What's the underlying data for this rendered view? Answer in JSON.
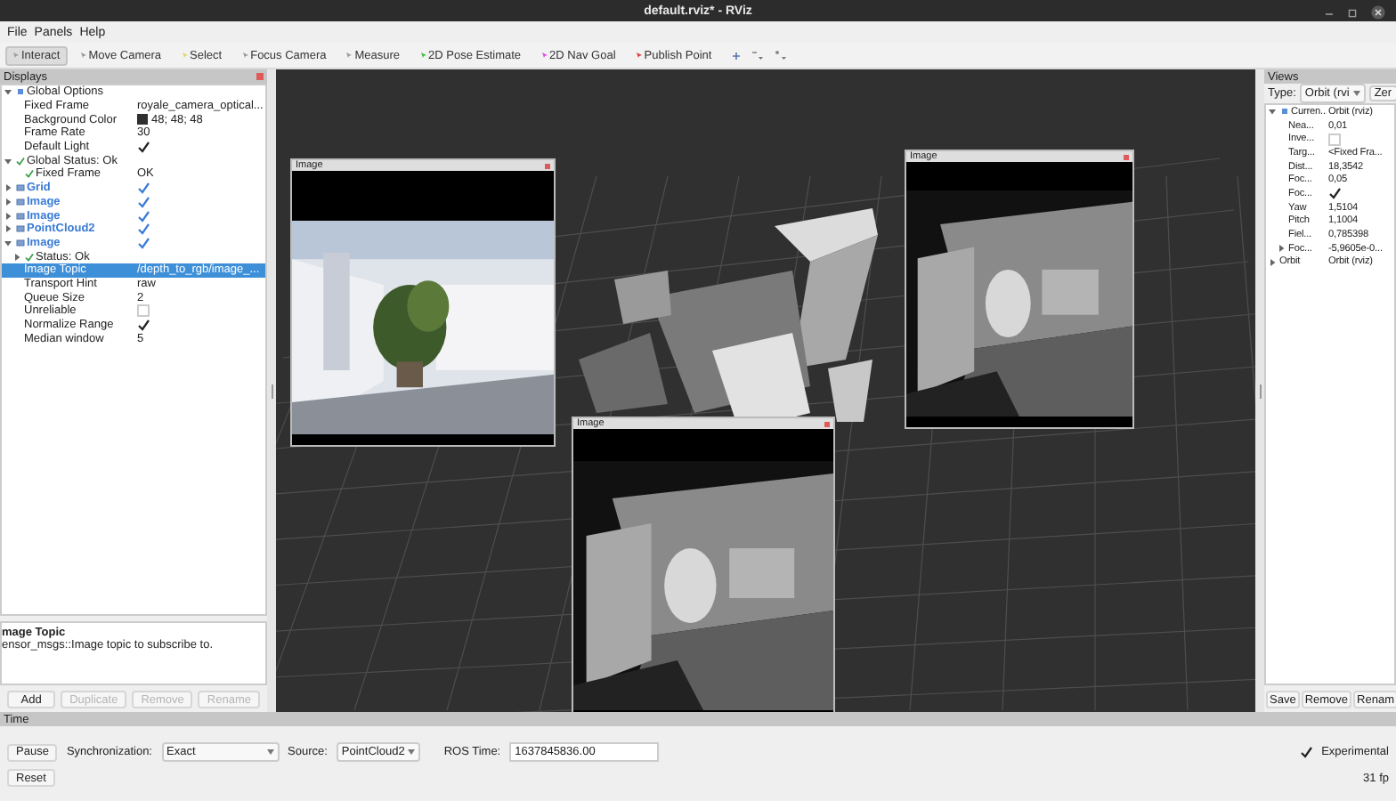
{
  "window": {
    "title": "default.rviz* - RViz"
  },
  "menu": [
    "File",
    "Panels",
    "Help"
  ],
  "tools": [
    {
      "label": "Interact",
      "selected": true,
      "color": "#9a9a9a"
    },
    {
      "label": "Move Camera",
      "selected": false,
      "color": "#9a9a9a"
    },
    {
      "label": "Select",
      "selected": false,
      "color": "#e6d36a"
    },
    {
      "label": "Focus Camera",
      "selected": false,
      "color": "#9a9a9a"
    },
    {
      "label": "Measure",
      "selected": false,
      "color": "#9a9a9a"
    },
    {
      "label": "2D Pose Estimate",
      "selected": false,
      "color": "#44c044"
    },
    {
      "label": "2D Nav Goal",
      "selected": false,
      "color": "#e050e0"
    },
    {
      "label": "Publish Point",
      "selected": false,
      "color": "#e03a3a"
    }
  ],
  "displays": {
    "title": "Displays",
    "items": [
      {
        "kind": "group",
        "label": "Global Options",
        "expanded": true,
        "selected": false,
        "children": [
          {
            "kind": "property",
            "label": "Fixed Frame",
            "value": "royale_camera_optical...",
            "selected": false
          },
          {
            "kind": "color",
            "label": "Background Color",
            "value": "48; 48; 48",
            "color": "#303030",
            "selected": false
          },
          {
            "kind": "property",
            "label": "Frame Rate",
            "value": "30",
            "selected": false
          },
          {
            "kind": "bool",
            "label": "Default Light",
            "checked": true,
            "selected": false
          }
        ]
      },
      {
        "kind": "status",
        "label": "Global Status: Ok",
        "expanded": true,
        "selected": false,
        "children": [
          {
            "kind": "status",
            "label": "Fixed Frame",
            "value": "OK",
            "selected": false
          }
        ]
      },
      {
        "kind": "display",
        "label": "Grid",
        "checked": true,
        "expanded": false,
        "selected": false
      },
      {
        "kind": "display",
        "label": "Image",
        "checked": true,
        "expanded": false,
        "selected": false
      },
      {
        "kind": "display",
        "label": "Image",
        "checked": true,
        "expanded": false,
        "selected": false
      },
      {
        "kind": "display",
        "label": "PointCloud2",
        "checked": true,
        "expanded": false,
        "selected": false
      },
      {
        "kind": "display",
        "label": "Image",
        "checked": true,
        "expanded": true,
        "selected": false,
        "children": [
          {
            "kind": "status",
            "label": "Status: Ok",
            "expanded": false,
            "selected": false
          },
          {
            "kind": "property",
            "label": "Image Topic",
            "value": "/depth_to_rgb/image_...",
            "selected": true
          },
          {
            "kind": "property",
            "label": "Transport Hint",
            "value": "raw",
            "selected": false
          },
          {
            "kind": "property",
            "label": "Queue Size",
            "value": "2",
            "selected": false
          },
          {
            "kind": "bool",
            "label": "Unreliable",
            "checked": false,
            "selected": false
          },
          {
            "kind": "bool",
            "label": "Normalize Range",
            "checked": true,
            "selected": false
          },
          {
            "kind": "property",
            "label": "Median window",
            "value": "5",
            "selected": false
          }
        ]
      }
    ],
    "description": {
      "title": "mage Topic",
      "text": "ensor_msgs::Image topic to subscribe to."
    },
    "buttons": [
      {
        "label": "Add",
        "disabled": false
      },
      {
        "label": "Duplicate",
        "disabled": true
      },
      {
        "label": "Remove",
        "disabled": true
      },
      {
        "label": "Rename",
        "disabled": true
      }
    ]
  },
  "image_windows": [
    {
      "title": "Image",
      "kind": "color"
    },
    {
      "title": "Image",
      "kind": "depth"
    },
    {
      "title": "Image",
      "kind": "depth"
    }
  ],
  "views": {
    "title": "Views",
    "type_label": "Type:",
    "type_value": "Orbit (rvi",
    "zero_button": "Zer",
    "items": [
      {
        "kind": "group",
        "label": "Curren...",
        "value": "Orbit (rviz)",
        "expanded": true,
        "selected": false,
        "children": [
          {
            "kind": "property",
            "label": "Nea...",
            "value": "0,01",
            "selected": false
          },
          {
            "kind": "bool",
            "label": "Inve...",
            "checked": false,
            "selected": false
          },
          {
            "kind": "property",
            "label": "Targ...",
            "value": "<Fixed Fra...",
            "selected": false
          },
          {
            "kind": "property",
            "label": "Dist...",
            "value": "18,3542",
            "selected": false
          },
          {
            "kind": "property",
            "label": "Foc...",
            "value": "0,05",
            "selected": false
          },
          {
            "kind": "bool",
            "label": "Foc...",
            "checked": true,
            "selected": false
          },
          {
            "kind": "property",
            "label": "Yaw",
            "value": "1,5104",
            "selected": false
          },
          {
            "kind": "property",
            "label": "Pitch",
            "value": "1,1004",
            "selected": false
          },
          {
            "kind": "property",
            "label": "Fiel...",
            "value": "0,785398",
            "selected": false
          },
          {
            "kind": "property",
            "label": "Foc...",
            "value": "-5,9605e-0...",
            "expanded": false,
            "selected": false
          }
        ]
      },
      {
        "kind": "property",
        "label": "Orbit",
        "value": "Orbit (rviz)",
        "expanded": false,
        "selected": false
      }
    ],
    "buttons": [
      {
        "label": "Save",
        "disabled": false
      },
      {
        "label": "Remove",
        "disabled": false
      },
      {
        "label": "Renam",
        "disabled": false
      }
    ]
  },
  "time": {
    "title": "Time",
    "pause": "Pause",
    "sync_label": "Synchronization:",
    "sync_value": "Exact",
    "source_label": "Source:",
    "source_value": "PointCloud2",
    "ros_time_label": "ROS Time:",
    "ros_time": "1637845836.00",
    "experimental": {
      "label": "Experimental",
      "checked": true
    },
    "reset": "Reset",
    "fps": "31 fp"
  }
}
